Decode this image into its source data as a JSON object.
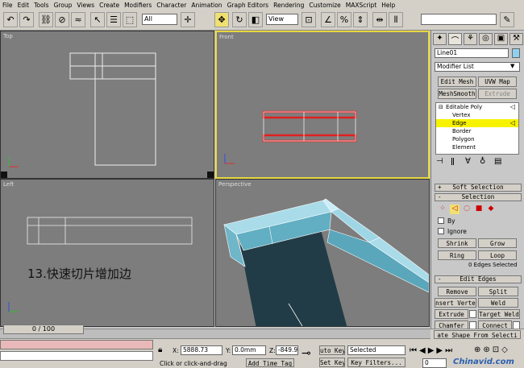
{
  "menu": [
    "File",
    "Edit",
    "Tools",
    "Group",
    "Views",
    "Create",
    "Modifiers",
    "Character",
    "Animation",
    "Graph Editors",
    "Rendering",
    "Customize",
    "MAXScript",
    "Help"
  ],
  "toolbar": {
    "selection_filter": "All",
    "ref_coord": "View"
  },
  "viewports": {
    "top": "Top",
    "front": "Front",
    "left": "Left",
    "perspective": "Perspective"
  },
  "caption": "13.快速切片增加边",
  "command_panel": {
    "object_name": "Line01",
    "modifier_list": "Modifier List",
    "modifier_buttons": [
      "Edit Mesh",
      "UVW Map",
      "MeshSmooth",
      "Extrude"
    ],
    "stack": [
      {
        "label": "Editable Poly",
        "level": 0,
        "selected": false
      },
      {
        "label": "Vertex",
        "level": 1,
        "selected": false
      },
      {
        "label": "Edge",
        "level": 1,
        "selected": true
      },
      {
        "label": "Border",
        "level": 1,
        "selected": false
      },
      {
        "label": "Polygon",
        "level": 1,
        "selected": false
      },
      {
        "label": "Element",
        "level": 1,
        "selected": false
      }
    ],
    "rollouts": {
      "soft_selection": "Soft Selection",
      "selection": "Selection",
      "edit_edges": "Edit Edges"
    },
    "selection": {
      "by_label": "By",
      "ignore_label": "Ignore",
      "shrink": "Shrink",
      "grow": "Grow",
      "ring": "Ring",
      "loop": "Loop",
      "status": "0 Edges Selected"
    },
    "edit_edges_buttons": [
      "Remove",
      "Split",
      "nsert Verte",
      "Weld",
      "Extrude",
      "Target Weld",
      "Chamfer",
      "Connect",
      "ate Shape From Selecti"
    ]
  },
  "timeline": {
    "frame": "0 / 100"
  },
  "status": {
    "x_label": "X:",
    "x_value": "5888.73",
    "y_label": "Y:",
    "y_value": "0.0mm",
    "z_label": "Z:",
    "z_value": "-849.9",
    "prompt": "Click or click-and-drag",
    "add_time_tag": "Add Time Tag",
    "auto_key": "uto Key",
    "set_key": "Set Key",
    "key_mode": "Selected",
    "key_filters": "Key Filters...",
    "frame_field": "0"
  },
  "watermark": "Chinavid.com"
}
